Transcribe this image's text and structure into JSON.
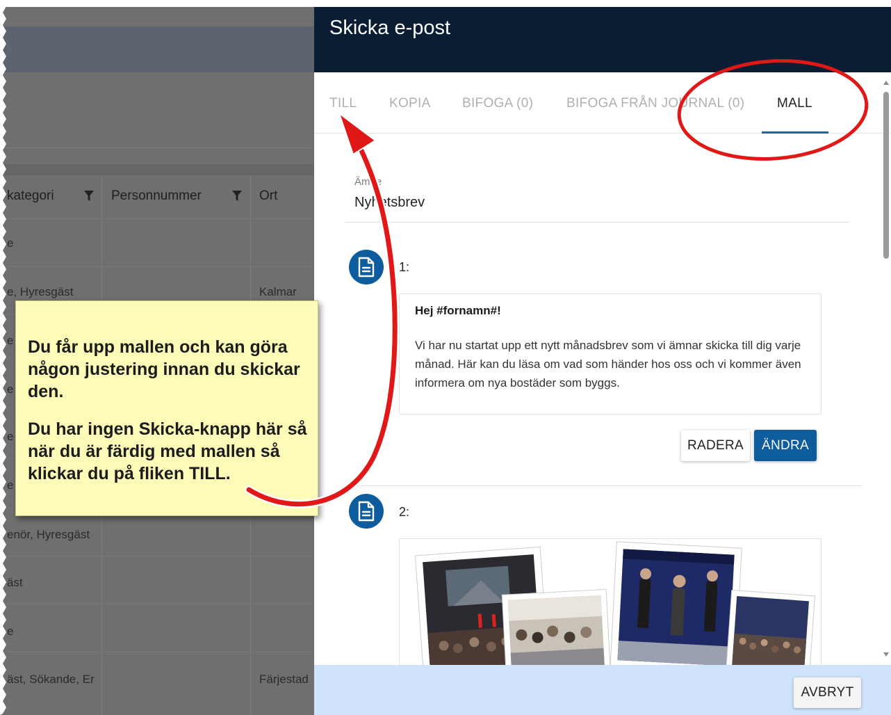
{
  "background_table": {
    "headers": [
      "kategori",
      "Personnummer",
      "Ort"
    ],
    "rows": [
      {
        "kategori": "e",
        "ort": ""
      },
      {
        "kategori": "e, Hyresgäst",
        "ort": "Kalmar"
      },
      {
        "kategori": "e",
        "ort": ""
      },
      {
        "kategori": "e",
        "ort": ""
      },
      {
        "kategori": "e",
        "ort": ""
      },
      {
        "kategori": "e",
        "ort": ""
      },
      {
        "kategori": "enör, Hyresgäst",
        "ort": ""
      },
      {
        "kategori": "äst",
        "ort": ""
      },
      {
        "kategori": "e",
        "ort": ""
      },
      {
        "kategori": "äst, Sökande, Er",
        "ort": "Färjestad"
      }
    ]
  },
  "dialog": {
    "title": "Skicka e-post",
    "tabs": [
      {
        "label": "TILL"
      },
      {
        "label": "KOPIA"
      },
      {
        "label": "BIFOGA (0)"
      },
      {
        "label": "BIFOGA FRÅN JOURNAL (0)"
      },
      {
        "label": "MALL",
        "active": true
      }
    ],
    "subject": {
      "label": "Ämne",
      "value": "Nyhetsbrev"
    },
    "items": [
      {
        "number": "1:",
        "greeting": "Hej #fornamn#!",
        "body": "Vi har nu startat upp ett nytt månadsbrev som vi ämnar skicka till dig varje månad. Här kan du läsa om vad som händer hos oss och vi kommer även informera om nya bostäder som byggs."
      },
      {
        "number": "2:"
      }
    ],
    "buttons": {
      "delete": "RADERA",
      "edit": "ÄNDRA",
      "cancel": "AVBRYT"
    }
  },
  "callout": {
    "paragraph1": "Du får upp mallen och kan göra någon justering innan du skickar den.",
    "paragraph2": "Du har ingen Skicka-knapp här så när du är färdig med mallen så klickar du på fliken TILL."
  },
  "colors": {
    "header_bg": "#0a1d33",
    "accent": "#0d5c9e",
    "footer_bg": "#cfe4fb",
    "callout_bg": "#fdfbb8",
    "annotation_red": "#e01818"
  }
}
